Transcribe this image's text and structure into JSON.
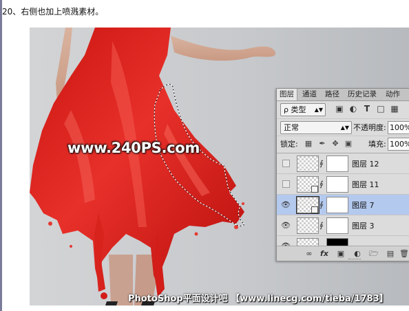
{
  "caption": "20、右侧也加上喷溅素材。",
  "watermark": "www.240PS.com",
  "footer_credit": "PhotoShop平面设计吧 【www.linecg.com/tieba/1783】",
  "colors": {
    "dress_red": "#e8302a",
    "selection_blue": "#b4c9ee",
    "panel_bg": "#dcdcdc"
  },
  "panel": {
    "tabs": [
      "图层",
      "通道",
      "路径",
      "历史记录",
      "动作"
    ],
    "filter": {
      "label": "ρ 类型",
      "icons": [
        "image-filter-icon",
        "adjustment-filter-icon",
        "type-filter-icon",
        "shape-filter-icon",
        "smart-object-filter-icon"
      ]
    },
    "blend_mode": "正常",
    "opacity_label": "不透明度:",
    "opacity_value": "100%",
    "lock_label": "锁定:",
    "fill_label": "填充:",
    "fill_value": "100%",
    "layers": [
      {
        "name": "图层 12",
        "visible": false,
        "selected": false,
        "smart": false
      },
      {
        "name": "图层 11",
        "visible": false,
        "selected": false,
        "smart": true
      },
      {
        "name": "图层 7",
        "visible": true,
        "selected": true,
        "smart": true
      },
      {
        "name": "图层 3",
        "visible": true,
        "selected": false,
        "smart": false
      },
      {
        "name": "",
        "visible": true,
        "selected": false,
        "smart": false
      }
    ],
    "bottom_icons": [
      "link-layers-icon",
      "fx-icon",
      "add-mask-icon",
      "adjustment-layer-icon",
      "new-group-icon",
      "new-layer-icon",
      "trash-icon"
    ],
    "fx_label": "fx"
  }
}
